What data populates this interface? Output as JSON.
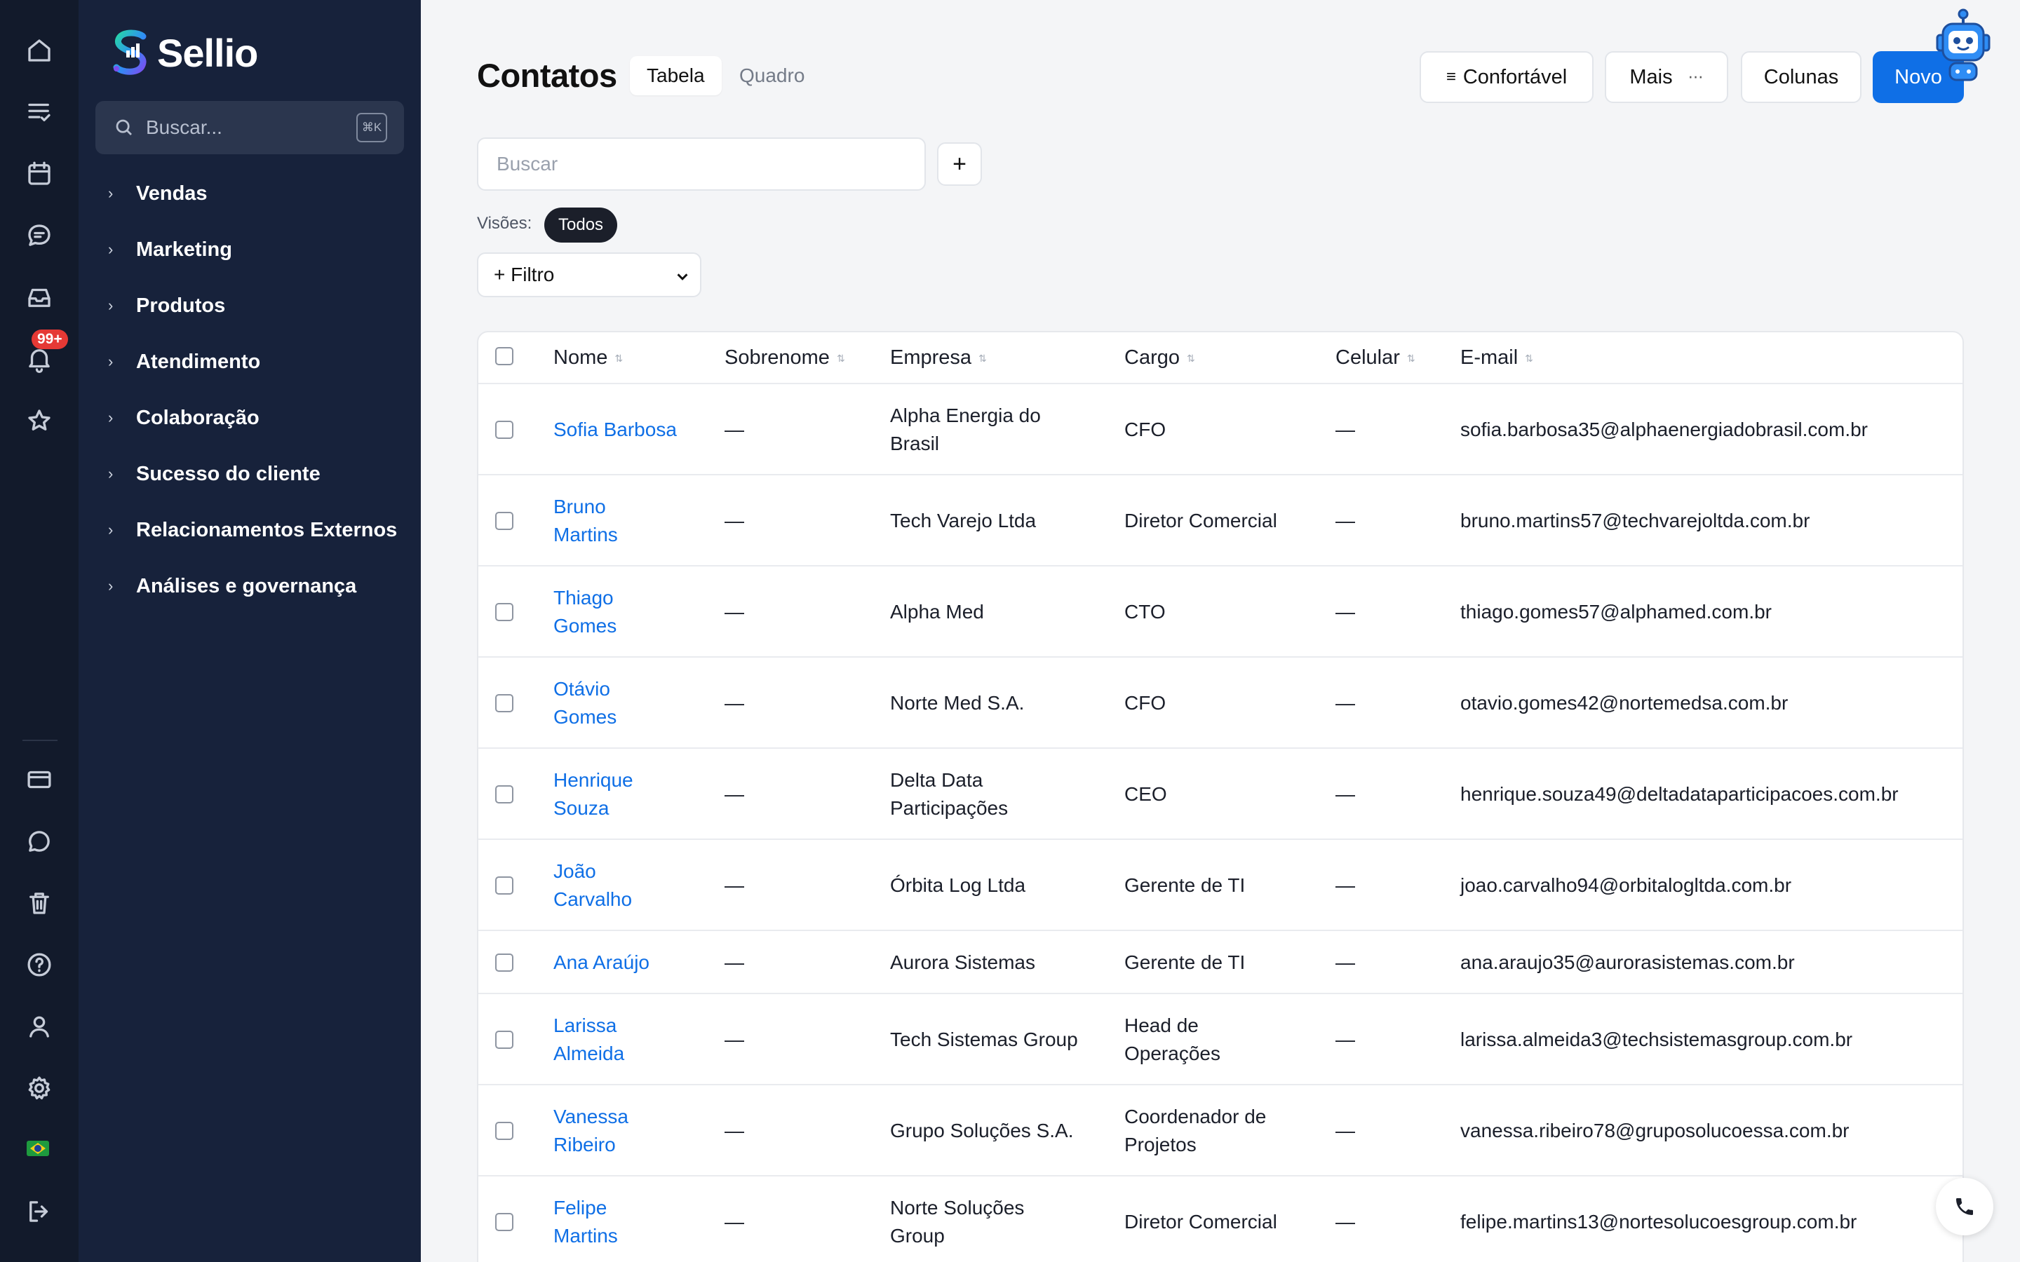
{
  "app": {
    "name": "Sellio"
  },
  "sidebar": {
    "search_placeholder": "Buscar...",
    "shortcut": "⌘K",
    "items": [
      {
        "label": "Vendas"
      },
      {
        "label": "Marketing"
      },
      {
        "label": "Produtos"
      },
      {
        "label": "Atendimento"
      },
      {
        "label": "Colaboração"
      },
      {
        "label": "Sucesso do cliente"
      },
      {
        "label": "Relacionamentos Externos"
      },
      {
        "label": "Análises e governança"
      }
    ]
  },
  "rail": {
    "icons": [
      "home-icon",
      "tasks-icon",
      "calendar-icon",
      "chat-icon",
      "inbox-icon",
      "bell-icon",
      "star-icon",
      "card-icon",
      "message-icon",
      "trash-icon",
      "help-icon",
      "user-icon",
      "settings-icon",
      "brazil-flag-icon",
      "logout-icon"
    ],
    "notification_badge": "99+"
  },
  "header": {
    "title": "Contatos",
    "tabs": [
      {
        "label": "Tabela",
        "active": true
      },
      {
        "label": "Quadro",
        "active": false
      }
    ],
    "density_label": "Confortável",
    "more_label": "Mais",
    "more_icon": "⋯",
    "columns_label": "Colunas",
    "new_label": "Novo"
  },
  "search": {
    "placeholder": "Buscar",
    "add_label": "+"
  },
  "views": {
    "label": "Visões:",
    "active": "Todos"
  },
  "filter": {
    "selected": "+ Filtro"
  },
  "table": {
    "columns": [
      "Nome",
      "Sobrenome",
      "Empresa",
      "Cargo",
      "Celular",
      "E-mail"
    ],
    "rows": [
      {
        "nome": [
          "Sofia Barbosa"
        ],
        "sobrenome": "—",
        "empresa": [
          "Alpha Energia do",
          "Brasil"
        ],
        "cargo": [
          "CFO"
        ],
        "celular": "—",
        "email": "sofia.barbosa35@alphaenergiadobrasil.com.br"
      },
      {
        "nome": [
          "Bruno",
          "Martins"
        ],
        "sobrenome": "—",
        "empresa": [
          "Tech Varejo Ltda"
        ],
        "cargo": [
          "Diretor Comercial"
        ],
        "celular": "—",
        "email": "bruno.martins57@techvarejoltda.com.br"
      },
      {
        "nome": [
          "Thiago",
          "Gomes"
        ],
        "sobrenome": "—",
        "empresa": [
          "Alpha Med"
        ],
        "cargo": [
          "CTO"
        ],
        "celular": "—",
        "email": "thiago.gomes57@alphamed.com.br"
      },
      {
        "nome": [
          "Otávio",
          "Gomes"
        ],
        "sobrenome": "—",
        "empresa": [
          "Norte Med S.A."
        ],
        "cargo": [
          "CFO"
        ],
        "celular": "—",
        "email": "otavio.gomes42@nortemedsa.com.br"
      },
      {
        "nome": [
          "Henrique",
          "Souza"
        ],
        "sobrenome": "—",
        "empresa": [
          "Delta Data",
          "Participações"
        ],
        "cargo": [
          "CEO"
        ],
        "celular": "—",
        "email": "henrique.souza49@deltadataparticipacoes.com.br"
      },
      {
        "nome": [
          "João",
          "Carvalho"
        ],
        "sobrenome": "—",
        "empresa": [
          "Órbita Log Ltda"
        ],
        "cargo": [
          "Gerente de TI"
        ],
        "celular": "—",
        "email": "joao.carvalho94@orbitalogltda.com.br"
      },
      {
        "nome": [
          "Ana Araújo"
        ],
        "sobrenome": "—",
        "empresa": [
          "Aurora Sistemas"
        ],
        "cargo": [
          "Gerente de TI"
        ],
        "celular": "—",
        "email": "ana.araujo35@aurorasistemas.com.br"
      },
      {
        "nome": [
          "Larissa",
          "Almeida"
        ],
        "sobrenome": "—",
        "empresa": [
          "Tech Sistemas Group"
        ],
        "cargo": [
          "Head de",
          "Operações"
        ],
        "celular": "—",
        "email": "larissa.almeida3@techsistemasgroup.com.br"
      },
      {
        "nome": [
          "Vanessa",
          "Ribeiro"
        ],
        "sobrenome": "—",
        "empresa": [
          "Grupo Soluções S.A."
        ],
        "cargo": [
          "Coordenador de",
          "Projetos"
        ],
        "celular": "—",
        "email": "vanessa.ribeiro78@gruposolucoessa.com.br"
      },
      {
        "nome": [
          "Felipe",
          "Martins"
        ],
        "sobrenome": "—",
        "empresa": [
          "Norte Soluções",
          "Group"
        ],
        "cargo": [
          "Diretor Comercial"
        ],
        "celular": "—",
        "email": "felipe.martins13@nortesolucoesgroup.com.br"
      }
    ]
  }
}
